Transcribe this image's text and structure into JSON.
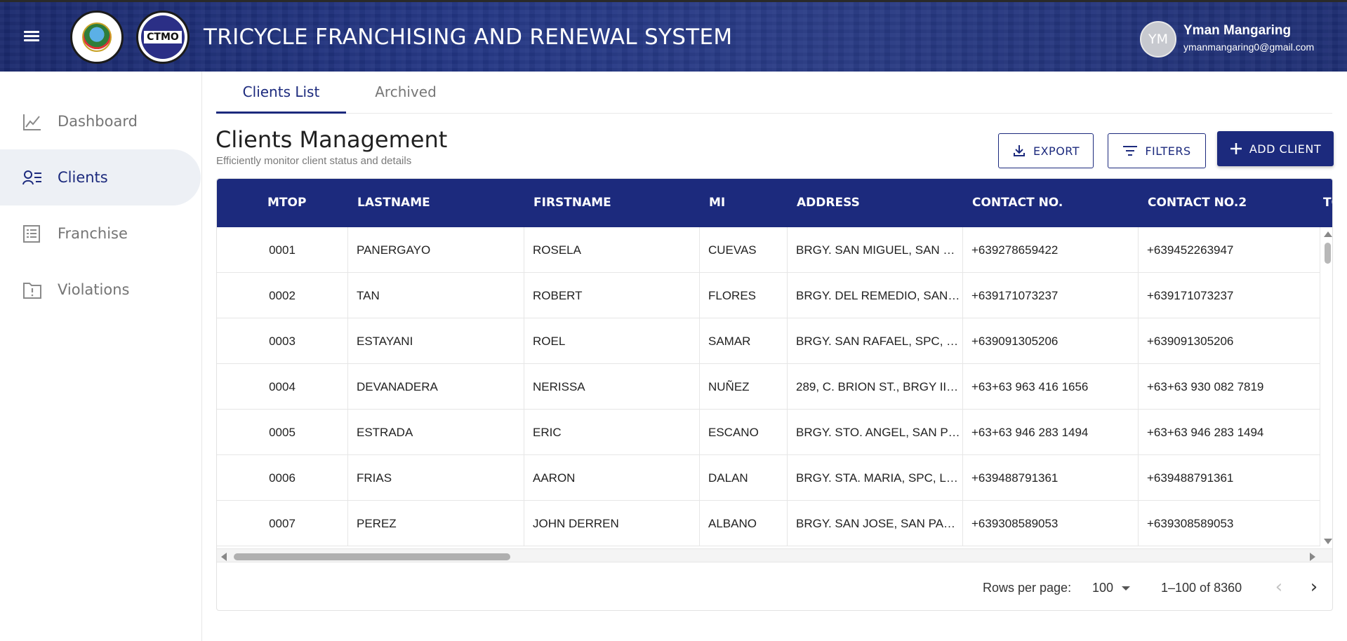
{
  "header": {
    "title": "TRICYCLE FRANCHISING AND RENEWAL SYSTEM",
    "seal1_text": "CITY OF SAN PABLO OFFICIAL SEAL",
    "seal2_text": "CTMO",
    "user": {
      "initials": "YM",
      "name": "Yman Mangaring",
      "email": "ymanmangaring0@gmail.com"
    }
  },
  "sidebar": {
    "items": [
      {
        "label": "Dashboard",
        "icon": "trending-up-icon",
        "active": false
      },
      {
        "label": "Clients",
        "icon": "people-list-icon",
        "active": true
      },
      {
        "label": "Franchise",
        "icon": "list-alt-icon",
        "active": false
      },
      {
        "label": "Violations",
        "icon": "folder-alert-icon",
        "active": false
      }
    ]
  },
  "tabs": [
    {
      "label": "Clients List",
      "active": true
    },
    {
      "label": "Archived",
      "active": false
    }
  ],
  "page": {
    "title": "Clients Management",
    "subtitle": "Efficiently monitor client status and details"
  },
  "toolbar": {
    "export_label": "EXPORT",
    "filters_label": "FILTERS",
    "add_label": "ADD CLIENT"
  },
  "table": {
    "columns": [
      "MTOP",
      "LASTNAME",
      "FIRSTNAME",
      "MI",
      "ADDRESS",
      "CONTACT NO.",
      "CONTACT NO.2",
      "TO"
    ],
    "rows": [
      [
        "0001",
        "PANERGAYO",
        "ROSELA",
        "CUEVAS",
        "BRGY. SAN MIGUEL, SAN …",
        "+639278659422",
        "+639452263947"
      ],
      [
        "0002",
        "TAN",
        "ROBERT",
        "FLORES",
        "BRGY. DEL REMEDIO, SAN …",
        "+639171073237",
        "+639171073237"
      ],
      [
        "0003",
        "ESTAYANI",
        "ROEL",
        "SAMAR",
        "BRGY. SAN RAFAEL, SPC, …",
        "+639091305206",
        "+639091305206"
      ],
      [
        "0004",
        "DEVANADERA",
        "NERISSA",
        "NUÑEZ",
        "289, C. BRION ST., BRGY II…",
        "+63+63 963 416 1656",
        "+63+63 930 082 7819"
      ],
      [
        "0005",
        "ESTRADA",
        "ERIC",
        "ESCANO",
        "BRGY. STO. ANGEL, SAN P…",
        "+63+63 946 283 1494",
        "+63+63 946 283 1494"
      ],
      [
        "0006",
        "FRIAS",
        "AARON",
        "DALAN",
        "BRGY. STA. MARIA, SPC, L…",
        "+639488791361",
        "+639488791361"
      ],
      [
        "0007",
        "PEREZ",
        "JOHN DERREN",
        "ALBANO",
        "BRGY. SAN JOSE, SAN PA…",
        "+639308589053",
        "+639308589053"
      ]
    ]
  },
  "pagination": {
    "rows_label": "Rows per page:",
    "rows_value": "100",
    "range": "1–100 of 8360"
  },
  "colors": {
    "primary": "#1c2a7d",
    "sidebar_active_bg": "#edf0f5"
  }
}
